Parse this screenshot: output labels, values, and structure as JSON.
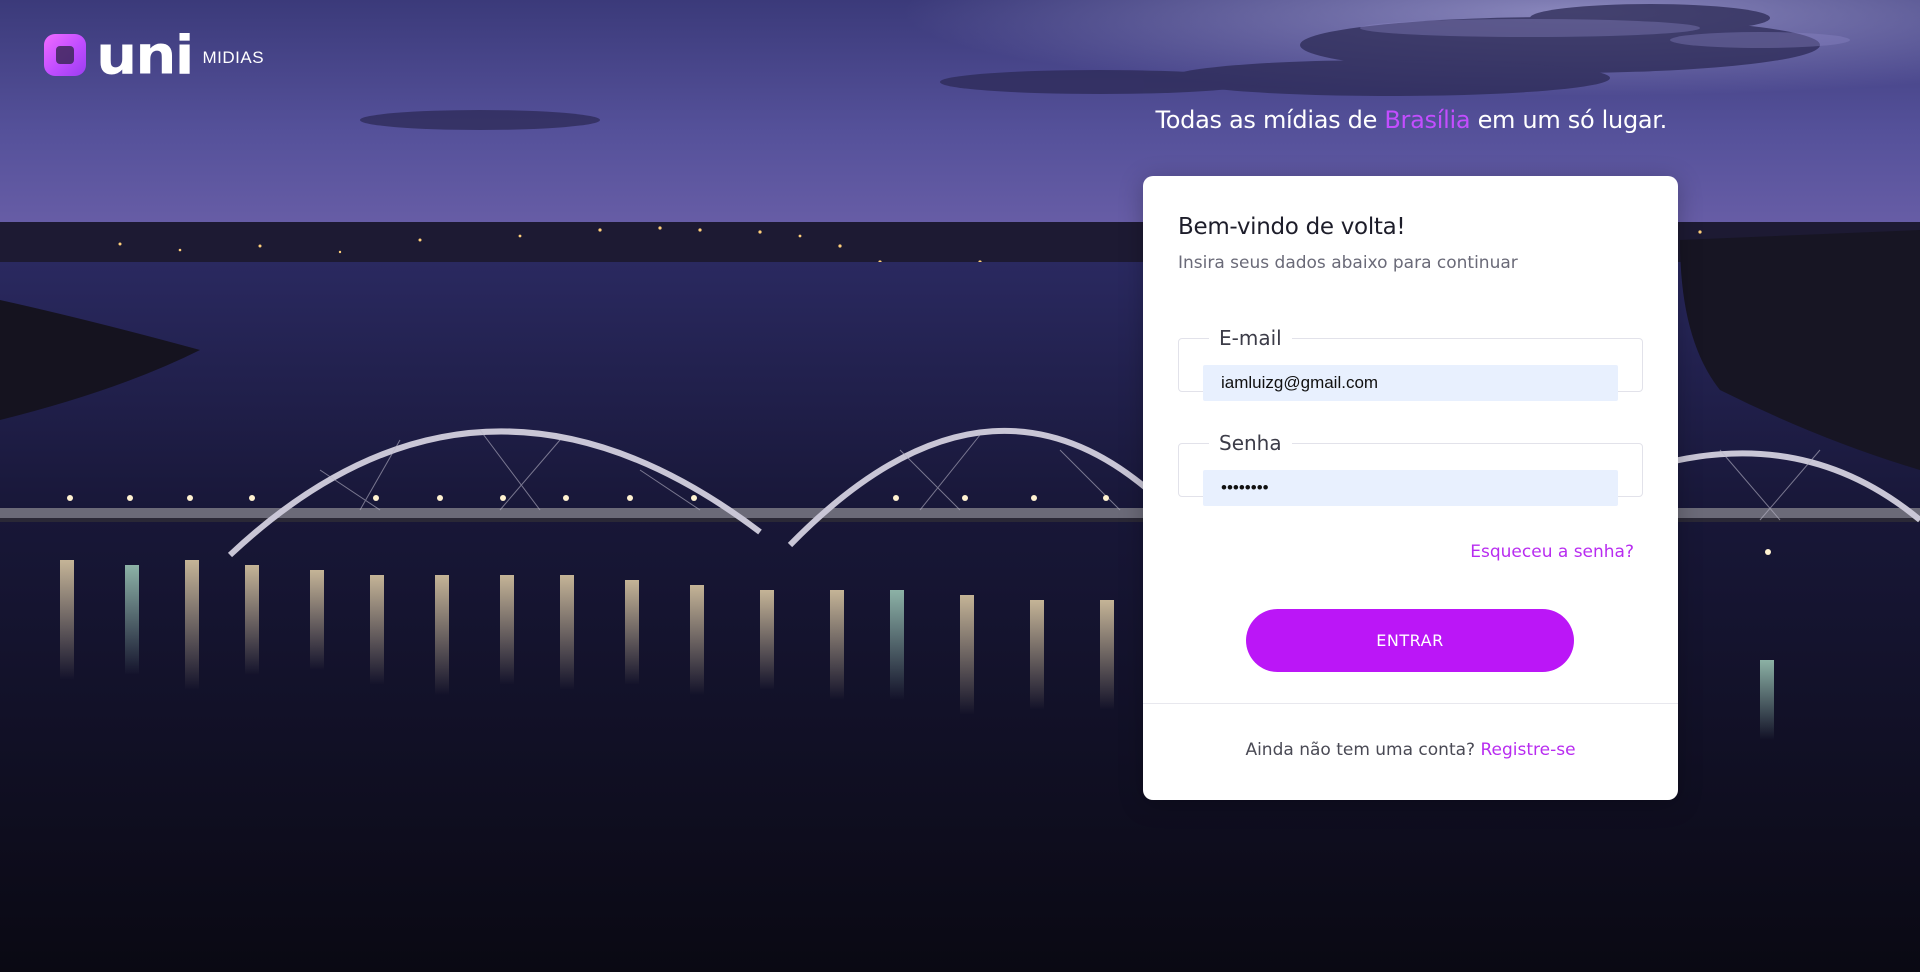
{
  "brand": {
    "wordmark": "uni",
    "subtitle": "MIDIAS"
  },
  "tagline": {
    "before": "Todas as mídias de ",
    "highlight": "Brasília",
    "after": " em um só lugar."
  },
  "login": {
    "title": "Bem-vindo de volta!",
    "subtitle": "Insira seus dados abaixo para continuar",
    "email": {
      "label": "E-mail",
      "value": "iamluizg@gmail.com"
    },
    "password": {
      "label": "Senha",
      "value": "12345678"
    },
    "forgot_link": "Esqueceu a senha?",
    "submit_label": "ENTRAR",
    "register_prompt": "Ainda não tem uma conta?",
    "register_link": "Registre-se"
  },
  "colors": {
    "accent": "#bb16f7",
    "link": "#b82cf0",
    "highlight": "#c34dff"
  }
}
